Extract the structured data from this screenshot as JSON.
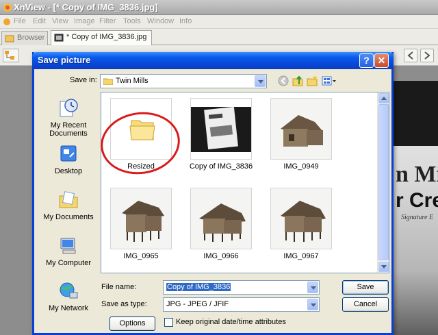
{
  "app": {
    "title": "XnView - [* Copy of IMG_3836.jpg]",
    "menu": [
      "File",
      "Edit",
      "View",
      "Image",
      "Filter",
      "Tools",
      "Window",
      "Info"
    ],
    "tabs": [
      {
        "label": "Browser",
        "active": false
      },
      {
        "label": "* Copy of IMG_3836.jpg",
        "active": true
      }
    ],
    "photo_text": {
      "line1": "n Mi",
      "line2": "r Cree",
      "line3": "Signature E"
    }
  },
  "dialog": {
    "title": "Save picture",
    "help_label": "?",
    "close_label": "✕",
    "save_in_label": "Save in:",
    "save_in_value": "Twin Mills",
    "places": [
      {
        "label": "My Recent Documents",
        "icon": "recent-documents-icon"
      },
      {
        "label": "Desktop",
        "icon": "desktop-icon"
      },
      {
        "label": "My Documents",
        "icon": "my-documents-icon"
      },
      {
        "label": "My Computer",
        "icon": "my-computer-icon"
      },
      {
        "label": "My Network",
        "icon": "my-network-icon"
      }
    ],
    "files": [
      {
        "name": "Resized",
        "kind": "folder"
      },
      {
        "name": "Copy of IMG_3836",
        "kind": "image"
      },
      {
        "name": "IMG_0949",
        "kind": "image"
      },
      {
        "name": "IMG_0965",
        "kind": "image"
      },
      {
        "name": "IMG_0966",
        "kind": "image"
      },
      {
        "name": "IMG_0967",
        "kind": "image"
      }
    ],
    "file_name_label": "File name:",
    "file_name_value": "Copy of IMG_3836",
    "save_as_type_label": "Save as type:",
    "save_as_type_value": "JPG - JPEG / JFIF",
    "save_button": "Save",
    "cancel_button": "Cancel",
    "options_button": "Options",
    "keep_date_label": "Keep original date/time attributes",
    "keep_date_checked": false
  },
  "colors": {
    "title_blue": "#0b5bea",
    "annotation_red": "#d91a1a",
    "dialog_face": "#ece9d8"
  }
}
